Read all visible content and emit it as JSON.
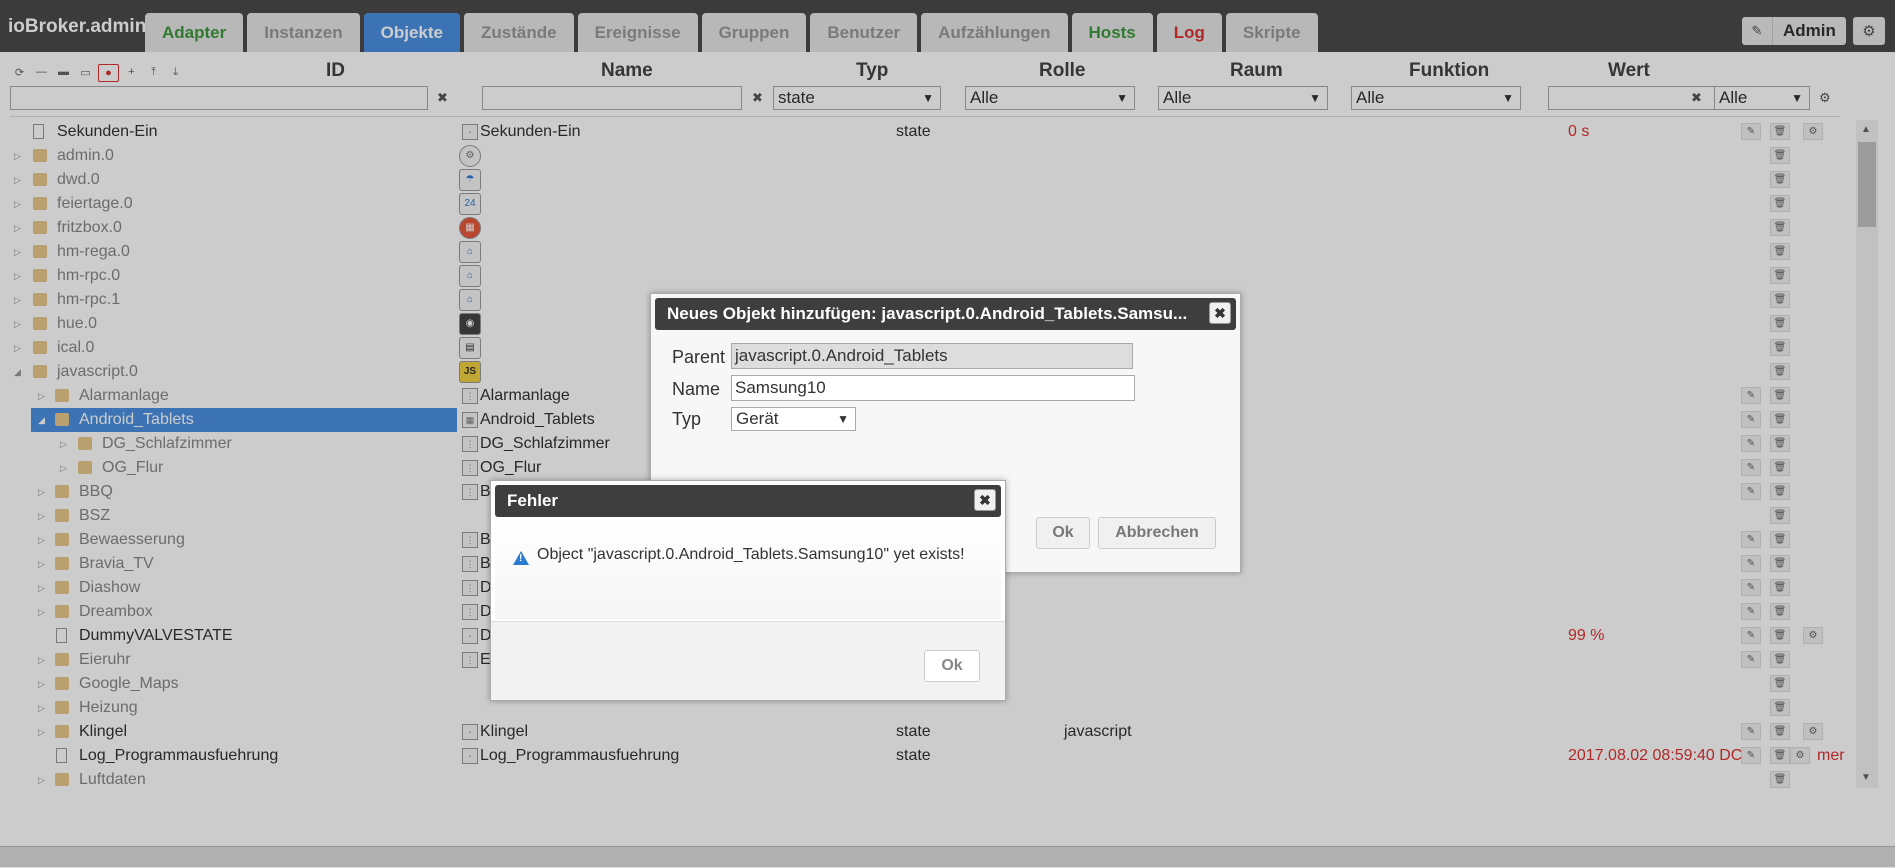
{
  "app": {
    "title": "ioBroker.admin"
  },
  "tabs": [
    {
      "label": "Adapter",
      "color": "green"
    },
    {
      "label": "Instanzen",
      "color": "grey"
    },
    {
      "label": "Objekte",
      "color": "active"
    },
    {
      "label": "Zustände",
      "color": "grey"
    },
    {
      "label": "Ereignisse",
      "color": "grey"
    },
    {
      "label": "Gruppen",
      "color": "grey"
    },
    {
      "label": "Benutzer",
      "color": "grey"
    },
    {
      "label": "Aufzählungen",
      "color": "grey"
    },
    {
      "label": "Hosts",
      "color": "green"
    },
    {
      "label": "Log",
      "color": "red"
    },
    {
      "label": "Skripte",
      "color": "grey"
    }
  ],
  "user": {
    "name": "Admin"
  },
  "columns": {
    "id": "ID",
    "name": "Name",
    "typ": "Typ",
    "rolle": "Rolle",
    "raum": "Raum",
    "funktion": "Funktion",
    "wert": "Wert"
  },
  "filters": {
    "typ": "state",
    "rolle": "Alle",
    "raum": "Alle",
    "funktion": "Alle",
    "wert": "Alle"
  },
  "rows": [
    {
      "id": "Sekunden-Ein",
      "name": "Sekunden-Ein",
      "typ": "state",
      "rolle": "",
      "wert": "0 s"
    },
    {
      "id": "admin.0",
      "name": "",
      "typ": "",
      "rolle": "",
      "wert": ""
    },
    {
      "id": "dwd.0",
      "name": "",
      "typ": "",
      "rolle": "",
      "wert": ""
    },
    {
      "id": "feiertage.0",
      "name": "",
      "typ": "",
      "rolle": "",
      "wert": ""
    },
    {
      "id": "fritzbox.0",
      "name": "",
      "typ": "",
      "rolle": "",
      "wert": ""
    },
    {
      "id": "hm-rega.0",
      "name": "",
      "typ": "",
      "rolle": "",
      "wert": ""
    },
    {
      "id": "hm-rpc.0",
      "name": "",
      "typ": "",
      "rolle": "",
      "wert": ""
    },
    {
      "id": "hm-rpc.1",
      "name": "",
      "typ": "",
      "rolle": "",
      "wert": ""
    },
    {
      "id": "hue.0",
      "name": "",
      "typ": "",
      "rolle": "",
      "wert": ""
    },
    {
      "id": "ical.0",
      "name": "",
      "typ": "",
      "rolle": "",
      "wert": ""
    },
    {
      "id": "javascript.0",
      "name": "",
      "typ": "",
      "rolle": "",
      "wert": ""
    },
    {
      "id": "Alarmanlage",
      "name": "Alarmanlage",
      "typ": "",
      "rolle": "",
      "wert": ""
    },
    {
      "id": "Android_Tablets",
      "name": "Android_Tablets",
      "typ": "",
      "rolle": "",
      "wert": ""
    },
    {
      "id": "DG_Schlafzimmer",
      "name": "DG_Schlafzimmer",
      "typ": "",
      "rolle": "",
      "wert": ""
    },
    {
      "id": "OG_Flur",
      "name": "OG_Flur",
      "typ": "",
      "rolle": "",
      "wert": ""
    },
    {
      "id": "BBQ",
      "name": "B",
      "typ": "",
      "rolle": "",
      "wert": ""
    },
    {
      "id": "BSZ",
      "name": "",
      "typ": "",
      "rolle": "",
      "wert": ""
    },
    {
      "id": "Bewaesserung",
      "name": "B",
      "typ": "",
      "rolle": "",
      "wert": ""
    },
    {
      "id": "Bravia_TV",
      "name": "B",
      "typ": "",
      "rolle": "",
      "wert": ""
    },
    {
      "id": "Diashow",
      "name": "D",
      "typ": "",
      "rolle": "",
      "wert": ""
    },
    {
      "id": "Dreambox",
      "name": "D",
      "typ": "",
      "rolle": "",
      "wert": ""
    },
    {
      "id": "DummyVALVESTATE",
      "name": "D",
      "typ": "",
      "rolle": "",
      "wert": "99 %"
    },
    {
      "id": "Eieruhr",
      "name": "E",
      "typ": "",
      "rolle": "",
      "wert": ""
    },
    {
      "id": "Google_Maps",
      "name": "",
      "typ": "",
      "rolle": "",
      "wert": ""
    },
    {
      "id": "Heizung",
      "name": "",
      "typ": "",
      "rolle": "",
      "wert": ""
    },
    {
      "id": "Klingel",
      "name": "Klingel",
      "typ": "state",
      "rolle": "javascript",
      "wert": ""
    },
    {
      "id": "Log_Programmausfuehrung",
      "name": "Log_Programmausfuehrung",
      "typ": "state",
      "rolle": "",
      "wert": "2017.08.02 08:59:40 DC"
    },
    {
      "id": "Luftdaten",
      "name": "",
      "typ": "",
      "rolle": "",
      "wert": ""
    }
  ],
  "trailing_value_fragment": "mer",
  "new_object_dialog": {
    "title": "Neues Objekt hinzufügen: javascript.0.Android_Tablets.Samsu...",
    "parent_label": "Parent",
    "parent_value": "javascript.0.Android_Tablets",
    "name_label": "Name",
    "name_value": "Samsung10",
    "typ_label": "Typ",
    "typ_value": "Gerät",
    "ok_label": "Ok",
    "cancel_label": "Abbrechen"
  },
  "error_dialog": {
    "title": "Fehler",
    "message": "Object \"javascript.0.Android_Tablets.Samsung10\" yet exists!",
    "ok_label": "Ok"
  },
  "adapter_icons": {
    "admin.0": "gear-icon",
    "dwd.0": "weather-icon",
    "feiertage.0": "calendar-24-icon",
    "fritzbox.0": "fritzbox-icon",
    "hm-rega.0": "homematic-icon",
    "hm-rpc.0": "homematic-icon",
    "hm-rpc.1": "homematic-icon",
    "hue.0": "hue-bridge-icon",
    "ical.0": "ical-icon",
    "javascript.0": "js-icon"
  },
  "colors": {
    "accent": "#4a90e2",
    "danger": "#dd3333",
    "success": "#3c9a3c",
    "topbar": "#4a4a4a"
  }
}
